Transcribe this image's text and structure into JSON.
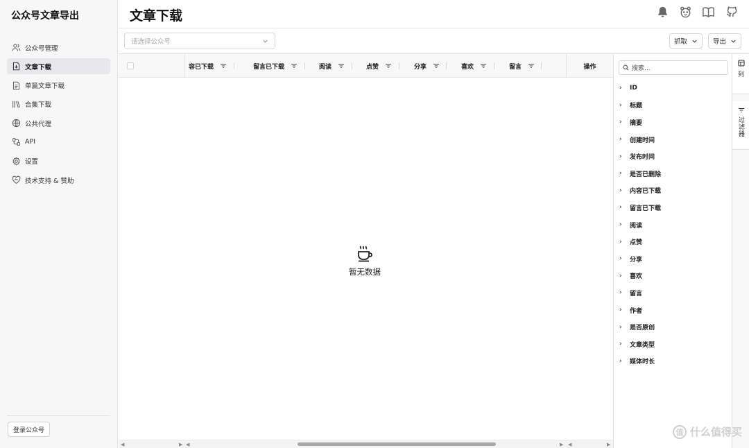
{
  "app": {
    "title": "公众号文章导出"
  },
  "sidebar": {
    "items": [
      {
        "label": "公众号管理",
        "icon": "users-icon",
        "active": false
      },
      {
        "label": "文章下载",
        "icon": "file-download-icon",
        "active": true
      },
      {
        "label": "单篇文章下载",
        "icon": "file-text-icon",
        "active": false
      },
      {
        "label": "合集下载",
        "icon": "library-icon",
        "active": false
      },
      {
        "label": "公共代理",
        "icon": "globe-icon",
        "active": false
      },
      {
        "label": "API",
        "icon": "api-icon",
        "active": false
      },
      {
        "label": "设置",
        "icon": "gear-icon",
        "active": false
      },
      {
        "label": "技术支持 & 赞助",
        "icon": "heart-handshake-icon",
        "active": false
      }
    ],
    "login_label": "登录公众号"
  },
  "header": {
    "title": "文章下载",
    "icons": [
      "bell-icon",
      "emoji-icon",
      "book-icon",
      "github-icon"
    ]
  },
  "toolbar": {
    "account_placeholder": "请选择公众号",
    "fetch_label": "抓取",
    "export_label": "导出"
  },
  "grid": {
    "columns": [
      "容已下载",
      "留言已下载",
      "阅读",
      "点赞",
      "分享",
      "喜欢",
      "留言"
    ],
    "action_column": "操作",
    "empty_text": "暂无数据"
  },
  "columns_panel": {
    "search_placeholder": "搜索...",
    "items": [
      "ID",
      "标题",
      "摘要",
      "创建时间",
      "发布时间",
      "是否已删除",
      "内容已下载",
      "留言已下载",
      "阅读",
      "点赞",
      "分享",
      "喜欢",
      "留言",
      "作者",
      "是否原创",
      "文章类型",
      "媒体时长"
    ]
  },
  "side_tabs": {
    "columns_label": "列",
    "filters_label": "过滤器"
  },
  "watermark": {
    "text": "什么值得买",
    "mark": "值"
  }
}
